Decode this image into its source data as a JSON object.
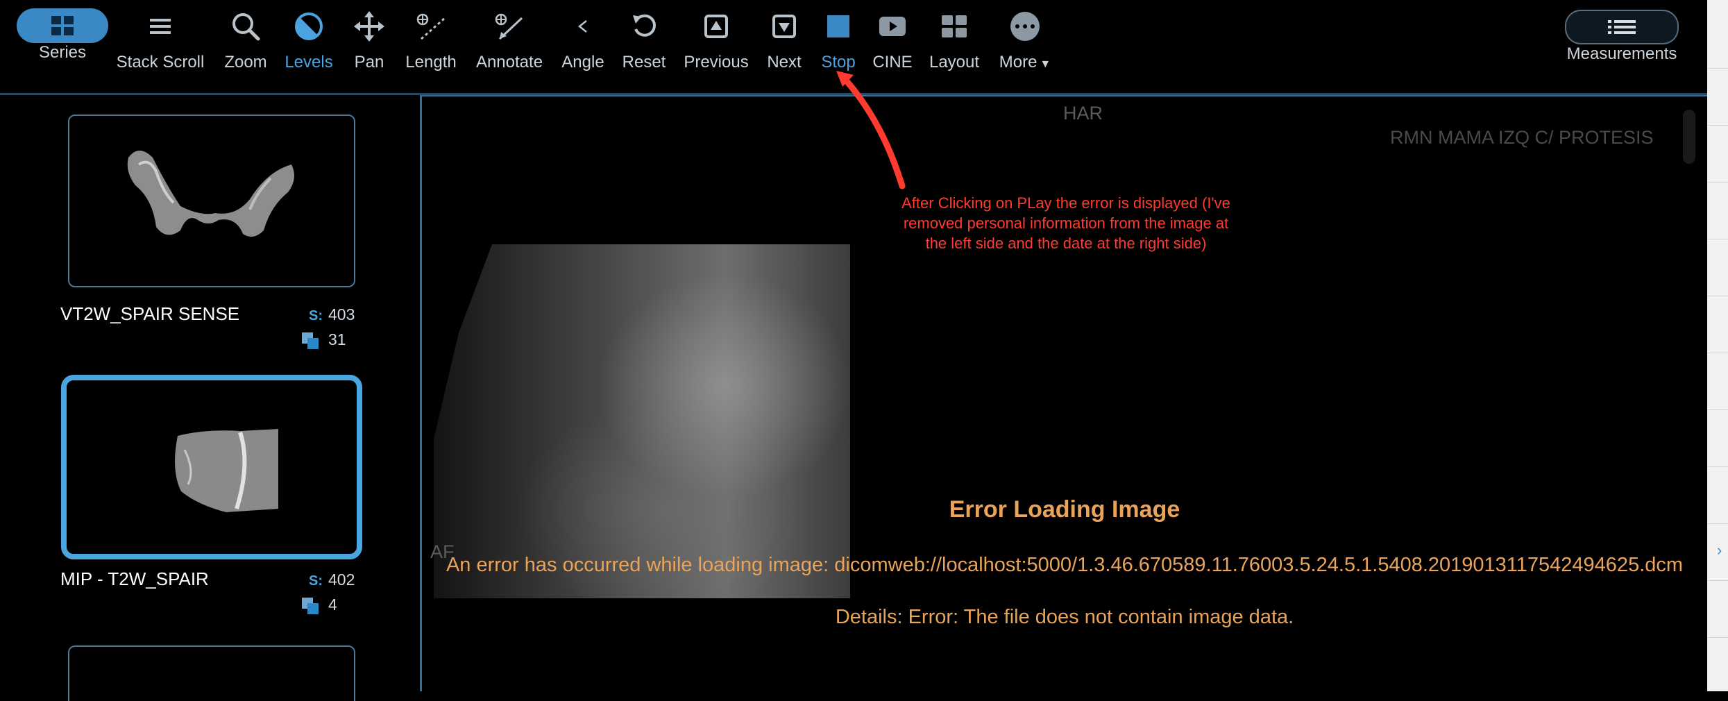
{
  "toolbar": {
    "items": [
      {
        "label": "Series",
        "icon": "grid-icon"
      },
      {
        "label": "Stack Scroll",
        "icon": "stack-scroll-icon"
      },
      {
        "label": "Zoom",
        "icon": "zoom-icon"
      },
      {
        "label": "Levels",
        "icon": "levels-icon"
      },
      {
        "label": "Pan",
        "icon": "pan-icon"
      },
      {
        "label": "Length",
        "icon": "length-icon"
      },
      {
        "label": "Annotate",
        "icon": "annotate-icon"
      },
      {
        "label": "Angle",
        "icon": "angle-icon"
      },
      {
        "label": "Reset",
        "icon": "reset-icon"
      },
      {
        "label": "Previous",
        "icon": "previous-icon"
      },
      {
        "label": "Next",
        "icon": "next-icon"
      },
      {
        "label": "Stop",
        "icon": "stop-icon"
      },
      {
        "label": "CINE",
        "icon": "cine-icon"
      },
      {
        "label": "Layout",
        "icon": "layout-icon"
      },
      {
        "label": "More",
        "icon": "more-icon"
      }
    ],
    "measurements_label": "Measurements",
    "active_color": "#4aa3df"
  },
  "series": [
    {
      "name": "VT2W_SPAIR SENSE",
      "s_label": "S:",
      "s_value": "403",
      "count": "31"
    },
    {
      "name": "MIP - T2W_SPAIR",
      "s_label": "S:",
      "s_value": "402",
      "count": "4"
    }
  ],
  "viewport": {
    "orientation_top": "HAR",
    "orientation_left": "AF",
    "description": "RMN MAMA IZQ C/ PROTESIS",
    "annotation": "After Clicking on PLay the error is displayed (I've removed personal information from the image at the left side and the date at the right side)",
    "annotation_color": "#ff3b2f",
    "error_title": "Error Loading Image",
    "error_message": "An error has occurred while loading image: dicomweb://localhost:5000/1.3.46.670589.11.76003.5.24.5.1.5408.2019013117542494625.dcm",
    "error_details": "Details: Error: The file does not contain image data.",
    "error_color": "#e9a45a"
  }
}
